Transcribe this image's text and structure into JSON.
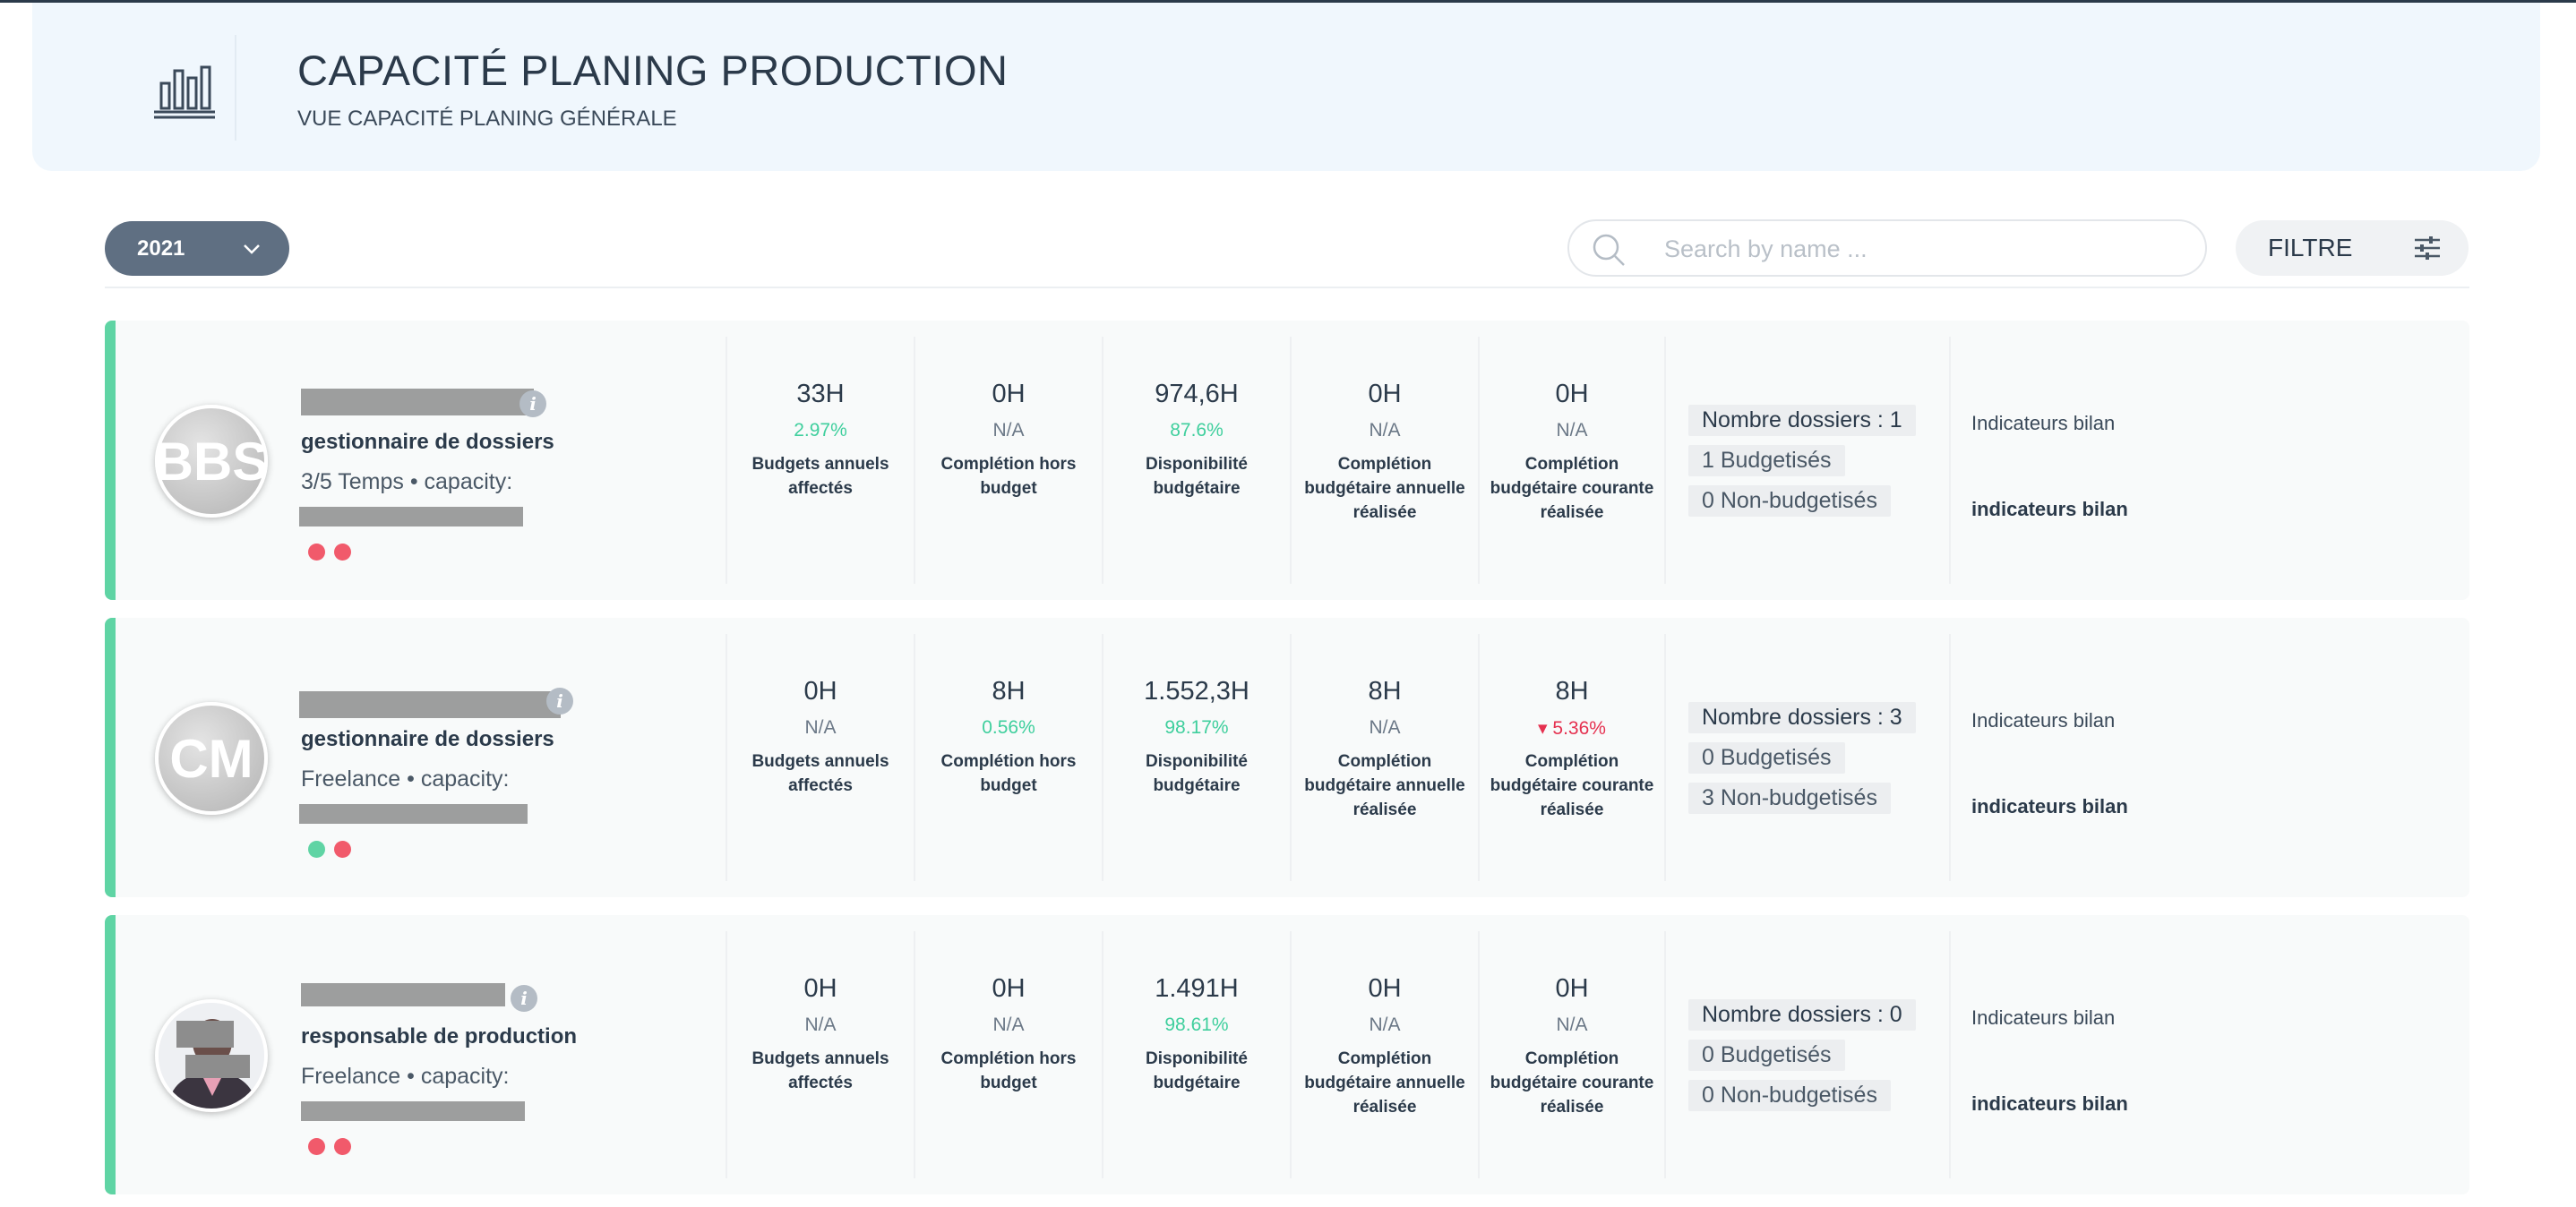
{
  "header": {
    "title": "CAPACITÉ PLANING PRODUCTION",
    "subtitle": "VUE CAPACITÉ PLANING GÉNÉRALE",
    "icon": "bar-chart-icon"
  },
  "toolbar": {
    "year": "2021",
    "search_placeholder": "Search by name ...",
    "filter_label": "FILTRE"
  },
  "metric_labels": {
    "affected": "Budgets annuels affectés",
    "extra": "Complétion hors budget",
    "availability": "Disponibilité budgétaire",
    "annual": "Complétion budgétaire annuelle réalisée",
    "current": "Complétion budgétaire courante réalisée"
  },
  "employees": [
    {
      "initials": "BBS",
      "role": "gestionnaire de dossiers",
      "capacity": "3/5 Temps • capacity:",
      "status_dots": [
        "red",
        "red"
      ],
      "metrics": [
        {
          "value": "33H",
          "pct": "2.97%",
          "pct_style": "green"
        },
        {
          "value": "0H",
          "pct": "N/A",
          "pct_style": "na"
        },
        {
          "value": "974,6H",
          "pct": "87.6%",
          "pct_style": "green"
        },
        {
          "value": "0H",
          "pct": "N/A",
          "pct_style": "na"
        },
        {
          "value": "0H",
          "pct": "N/A",
          "pct_style": "na"
        }
      ],
      "folders": {
        "total": "Nombre dossiers : 1",
        "budgeted": "1 Budgetisés",
        "non_budgeted": "0 Non-budgetisés"
      },
      "indicators_top": "Indicateurs bilan",
      "indicators_bottom": "indicateurs bilan"
    },
    {
      "initials": "CM",
      "role": "gestionnaire de dossiers",
      "capacity": "Freelance • capacity:",
      "status_dots": [
        "green",
        "red"
      ],
      "metrics": [
        {
          "value": "0H",
          "pct": "N/A",
          "pct_style": "na"
        },
        {
          "value": "8H",
          "pct": "0.56%",
          "pct_style": "green"
        },
        {
          "value": "1.552,3H",
          "pct": "98.17%",
          "pct_style": "green"
        },
        {
          "value": "8H",
          "pct": "N/A",
          "pct_style": "na"
        },
        {
          "value": "8H",
          "pct": "▾ 5.36%",
          "pct_style": "red"
        }
      ],
      "folders": {
        "total": "Nombre dossiers : 3",
        "budgeted": "0 Budgetisés",
        "non_budgeted": "3 Non-budgetisés"
      },
      "indicators_top": "Indicateurs bilan",
      "indicators_bottom": "indicateurs bilan"
    },
    {
      "initials": "",
      "role": "responsable de production",
      "capacity": "Freelance • capacity:",
      "status_dots": [
        "red",
        "red"
      ],
      "metrics": [
        {
          "value": "0H",
          "pct": "N/A",
          "pct_style": "na"
        },
        {
          "value": "0H",
          "pct": "N/A",
          "pct_style": "na"
        },
        {
          "value": "1.491H",
          "pct": "98.61%",
          "pct_style": "green"
        },
        {
          "value": "0H",
          "pct": "N/A",
          "pct_style": "na"
        },
        {
          "value": "0H",
          "pct": "N/A",
          "pct_style": "na"
        }
      ],
      "folders": {
        "total": "Nombre dossiers : 0",
        "budgeted": "0 Budgetisés",
        "non_budgeted": "0 Non-budgetisés"
      },
      "indicators_top": "Indicateurs bilan",
      "indicators_bottom": "indicateurs bilan"
    }
  ],
  "colors": {
    "accent": "#5fd4a4",
    "positive": "#3fcf9d",
    "negative": "#e5304f",
    "status_red": "#f15a6b"
  }
}
